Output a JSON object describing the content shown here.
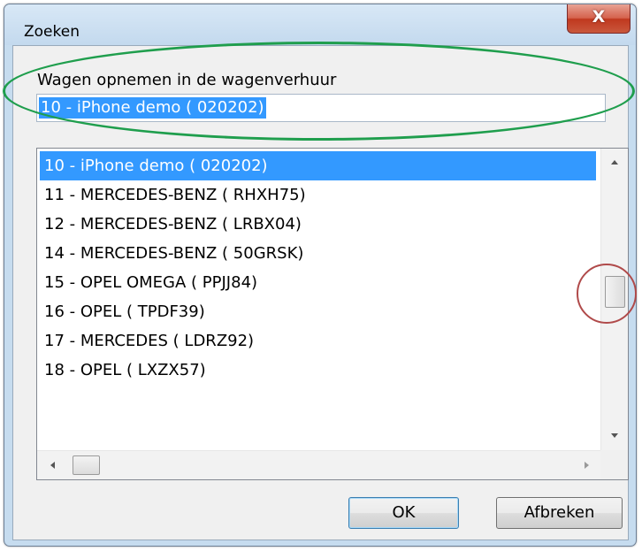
{
  "window": {
    "title": "Zoeken",
    "close_label": "X"
  },
  "dialog": {
    "prompt": "Wagen opnemen in de wagenverhuur",
    "search_value": "10 - iPhone demo ( 020202)"
  },
  "list": {
    "selected_index": 0,
    "items": [
      "10 - iPhone demo ( 020202)",
      "11 - MERCEDES-BENZ ( RHXH75)",
      "12 - MERCEDES-BENZ ( LRBX04)",
      "14 - MERCEDES-BENZ ( 50GRSK)",
      "15 - OPEL OMEGA ( PPJJ84)",
      "16 - OPEL ( TPDF39)",
      "17 - MERCEDES ( LDRZ92)",
      "18 - OPEL ( LXZX57)"
    ]
  },
  "buttons": {
    "ok": "OK",
    "cancel": "Afbreken"
  },
  "colors": {
    "selection": "#3399ff",
    "annotation_green": "#1f9e4d",
    "annotation_red": "#b04a4a",
    "close_button": "#c9452b"
  },
  "icons": [
    "close-icon",
    "scroll-up-icon",
    "scroll-down-icon",
    "scroll-left-icon",
    "scroll-right-icon"
  ]
}
